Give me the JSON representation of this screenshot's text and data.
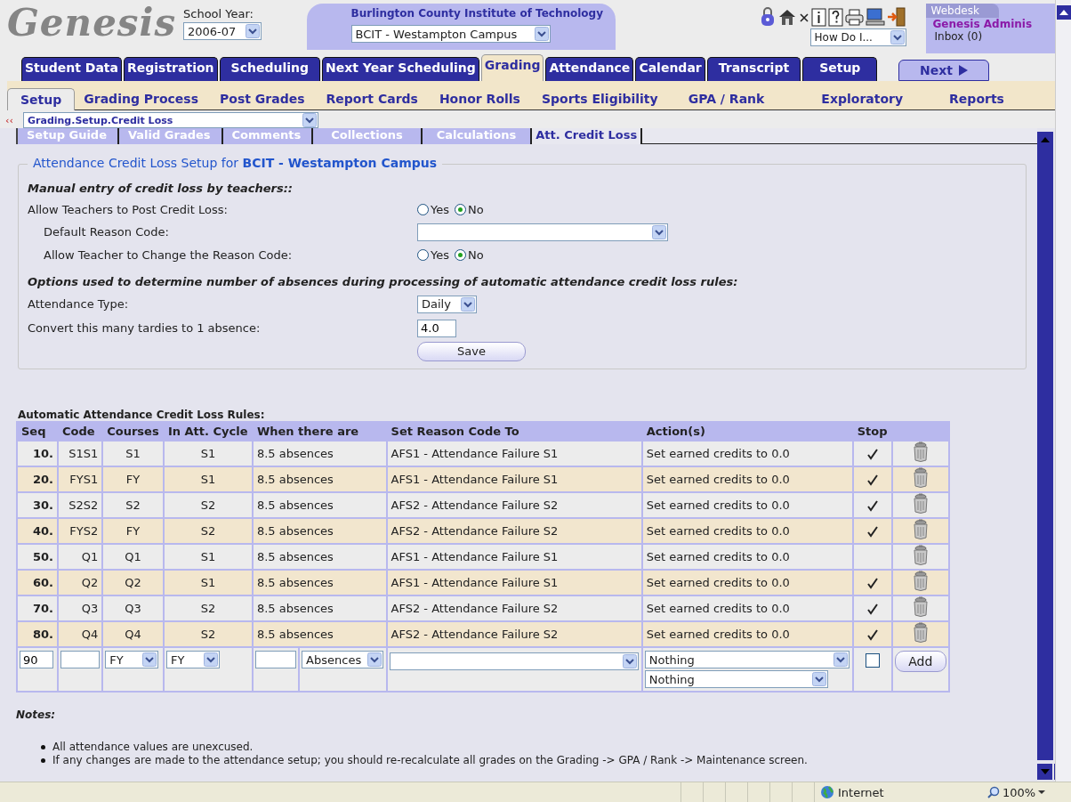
{
  "header": {
    "logo": "Genesis",
    "school_year": {
      "label": "School Year:",
      "value": "2006-07"
    },
    "district": {
      "name": "Burlington County Institute of Technology",
      "campus": "BCIT - Westampton Campus"
    },
    "help_select": "How Do I...",
    "webdesk": {
      "tab": "Webdesk",
      "user": "Genesis Adminis",
      "inbox": "Inbox (0)"
    }
  },
  "main_tabs": [
    {
      "label": "Student Data",
      "selected": false
    },
    {
      "label": "Registration",
      "selected": false
    },
    {
      "label": "Scheduling",
      "selected": false
    },
    {
      "label": "Next Year Scheduling",
      "selected": false
    },
    {
      "label": "Grading",
      "selected": true
    },
    {
      "label": "Attendance",
      "selected": false
    },
    {
      "label": "Calendar",
      "selected": false
    },
    {
      "label": "Transcript",
      "selected": false
    },
    {
      "label": "Setup",
      "selected": false
    }
  ],
  "next_button": "Next",
  "sub_nav": [
    {
      "label": "Setup",
      "selected": true
    },
    {
      "label": "Grading Process",
      "selected": false
    },
    {
      "label": "Post Grades",
      "selected": false
    },
    {
      "label": "Report Cards",
      "selected": false
    },
    {
      "label": "Honor Rolls",
      "selected": false
    },
    {
      "label": "Sports Eligibility",
      "selected": false
    },
    {
      "label": "GPA / Rank",
      "selected": false
    },
    {
      "label": "Exploratory",
      "selected": false
    },
    {
      "label": "Reports",
      "selected": false
    }
  ],
  "breadcrumb": {
    "collapse": "‹‹",
    "value": "Grading.Setup.Credit Loss"
  },
  "page_tabs": [
    {
      "label": "Setup Guide",
      "selected": false
    },
    {
      "label": "Valid Grades",
      "selected": false
    },
    {
      "label": "Comments",
      "selected": false
    },
    {
      "label": "Collections",
      "selected": false
    },
    {
      "label": "Calculations",
      "selected": false
    },
    {
      "label": "Att. Credit Loss",
      "selected": true
    }
  ],
  "form": {
    "legend": "Attendance Credit Loss Setup for **BCIT - Westampton Campus**",
    "rows": [
      {
        "kind": "heading",
        "label": "Manual entry of credit loss by teachers::"
      },
      {
        "kind": "radio",
        "label": "Allow Teachers to Post Credit Loss:",
        "options": [
          {
            "label": "Yes",
            "selected": false
          },
          {
            "label": "No",
            "selected": true
          }
        ]
      },
      {
        "kind": "select",
        "indent": true,
        "label": "Default Reason Code:"
      },
      {
        "kind": "radio",
        "indent": true,
        "label": "Allow Teacher to Change the Reason Code:",
        "options": [
          {
            "label": "Yes",
            "selected": false
          },
          {
            "label": "No",
            "selected": true
          }
        ]
      },
      {
        "kind": "heading",
        "label": "Options used to determine number of absences during processing of automatic attendance credit loss rules:"
      },
      {
        "kind": "select",
        "label": "Attendance Type:",
        "value": "Daily"
      },
      {
        "kind": "text",
        "label": "Convert this many tardies to 1 absence:",
        "value": "4.0"
      },
      {
        "kind": "button",
        "value": "Save"
      }
    ]
  },
  "rules": {
    "title": "Automatic Attendance Credit Loss Rules:",
    "columns": [
      "Seq",
      "Code",
      "Courses",
      "In Att. Cycle",
      "When there are",
      "Set Reason Code To",
      "Action(s)",
      "Stop"
    ],
    "rows": [
      {
        "seq": "10.",
        "code": "S1S1",
        "courses": "S1",
        "cycle": "S1",
        "when": "8.5 absences",
        "reason": "AFS1 - Attendance Failure S1",
        "action": "Set earned credits to 0.0",
        "stop": true
      },
      {
        "seq": "20.",
        "code": "FYS1",
        "courses": "FY",
        "cycle": "S1",
        "when": "8.5 absences",
        "reason": "AFS1 - Attendance Failure S1",
        "action": "Set earned credits to 0.0",
        "stop": true
      },
      {
        "seq": "30.",
        "code": "S2S2",
        "courses": "S2",
        "cycle": "S2",
        "when": "8.5 absences",
        "reason": "AFS2 - Attendance Failure S2",
        "action": "Set earned credits to 0.0",
        "stop": true
      },
      {
        "seq": "40.",
        "code": "FYS2",
        "courses": "FY",
        "cycle": "S2",
        "when": "8.5 absences",
        "reason": "AFS2 - Attendance Failure S2",
        "action": "Set earned credits to 0.0",
        "stop": true
      },
      {
        "seq": "50.",
        "code": "Q1",
        "courses": "Q1",
        "cycle": "S1",
        "when": "8.5 absences",
        "reason": "AFS1 - Attendance Failure S1",
        "action": "Set earned credits to 0.0",
        "stop": false
      },
      {
        "seq": "60.",
        "code": "Q2",
        "courses": "Q2",
        "cycle": "S1",
        "when": "8.5 absences",
        "reason": "AFS1 - Attendance Failure S1",
        "action": "Set earned credits to 0.0",
        "stop": true
      },
      {
        "seq": "70.",
        "code": "Q3",
        "courses": "Q3",
        "cycle": "S2",
        "when": "8.5 absences",
        "reason": "AFS2 - Attendance Failure S2",
        "action": "Set earned credits to 0.0",
        "stop": true
      },
      {
        "seq": "80.",
        "code": "Q4",
        "courses": "Q4",
        "cycle": "S2",
        "when": "8.5 absences",
        "reason": "AFS2 - Attendance Failure S2",
        "action": "Set earned credits to 0.0",
        "stop": true
      }
    ],
    "new_row": {
      "seq": "90",
      "courses": "FY",
      "cycle": "FY",
      "unit": "Absences",
      "action": "Nothing",
      "action_2": "Nothing",
      "stop": false,
      "add": "Add"
    }
  },
  "notes": {
    "title": "Notes:",
    "items": [
      "All attendance values are unexcused.",
      "If any changes are made to the attendance setup; you should re-recalculate all grades on the Grading -> GPA / Rank -> Maintenance screen."
    ]
  },
  "status_bar": {
    "zone": "Internet",
    "zoom": "100%"
  }
}
